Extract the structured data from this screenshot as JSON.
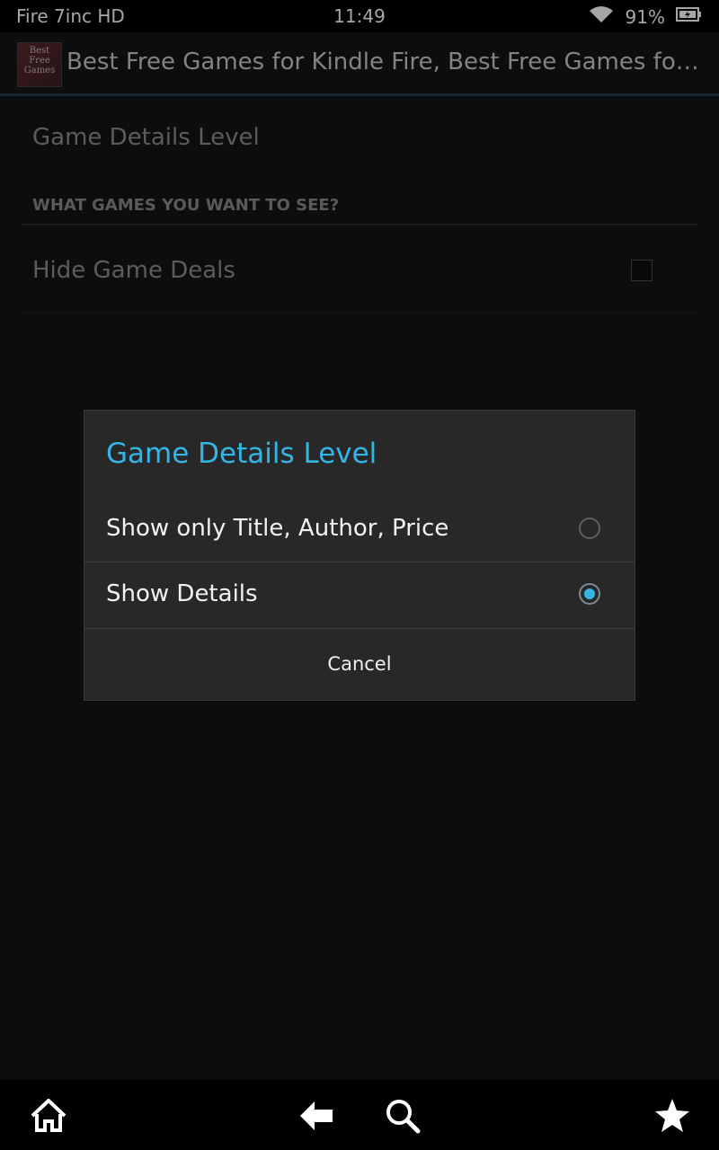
{
  "status_bar": {
    "device": "Fire 7inc HD",
    "time": "11:49",
    "battery": "91%",
    "icons": [
      "wifi-icon",
      "battery-icon"
    ]
  },
  "action_bar": {
    "app_icon_text": "Best Free Games",
    "title": "Best Free Games for Kindle Fire, Best Free Games for Kin…"
  },
  "preferences": {
    "game_details_level": "Game Details Level",
    "category_header": "WHAT GAMES YOU WANT TO SEE?",
    "hide_game_deals": "Hide Game Deals",
    "hide_game_deals_checked": false
  },
  "dialog": {
    "title": "Game Details Level",
    "options": [
      {
        "label": "Show only Title, Author, Price",
        "selected": false
      },
      {
        "label": "Show Details",
        "selected": true
      }
    ],
    "cancel": "Cancel",
    "accent_color": "#33b5e5"
  },
  "nav_bar": {
    "icons": [
      "home-icon",
      "back-icon",
      "search-icon",
      "favorites-star-icon"
    ]
  }
}
